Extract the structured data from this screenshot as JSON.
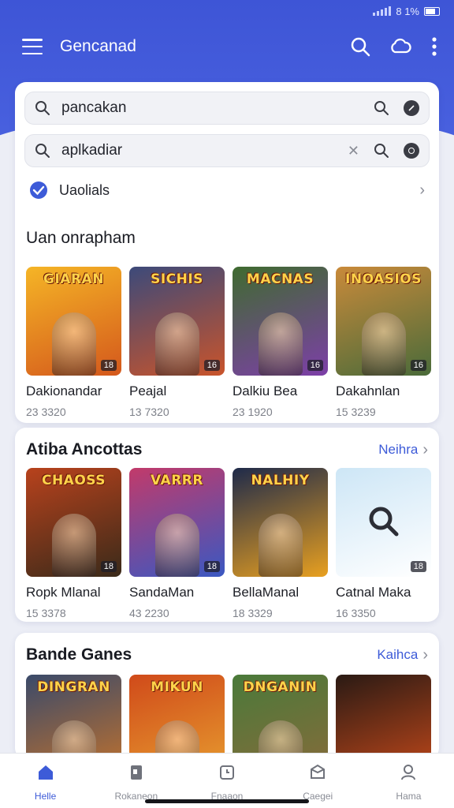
{
  "status": {
    "time": "8 1%",
    "signal": "signal-icon"
  },
  "app_bar": {
    "title": "Gencanad"
  },
  "search": {
    "field1_value": "pancakan",
    "field2_value": "aplkadiar"
  },
  "check_row": {
    "label": "Uaolials"
  },
  "section1": {
    "title": "Uan onrapham",
    "items": [
      {
        "art": "GIARAN",
        "name": "Dakionandar",
        "meta": "23 3320",
        "badge": "18",
        "colors": [
          "#f5b526",
          "#d4581c"
        ]
      },
      {
        "art": "SICHIS",
        "name": "Peajal",
        "meta": "13 7320",
        "badge": "16",
        "colors": [
          "#3c4a7a",
          "#c9542b"
        ]
      },
      {
        "art": "MACNAS",
        "name": "Dalkiu Bea",
        "meta": "23 1920",
        "badge": "16",
        "colors": [
          "#3f6b2f",
          "#7d3fa8"
        ]
      },
      {
        "art": "INOASIOS",
        "name": "Dakahnlan",
        "meta": "15 3239",
        "badge": "16",
        "colors": [
          "#c98a3a",
          "#4a6b3a"
        ]
      }
    ]
  },
  "section2": {
    "title": "Atiba Ancottas",
    "see_more": "Neihra",
    "items": [
      {
        "art": "CHAOSS",
        "name": "Ropk Mlanal",
        "meta": "15 3378",
        "badge": "18",
        "colors": [
          "#b8421c",
          "#3a2a1a"
        ]
      },
      {
        "art": "VARRR",
        "name": "SandaMan",
        "meta": "43 2230",
        "badge": "18",
        "colors": [
          "#c23a6a",
          "#3a58c2"
        ]
      },
      {
        "art": "NALHIY",
        "name": "BellaManal",
        "meta": "18 3329",
        "badge": "",
        "colors": [
          "#1e2a4a",
          "#e8a020"
        ]
      },
      {
        "art": "",
        "name": "Catnal Maka",
        "meta": "16 3350",
        "badge": "18",
        "colors": [
          "#cde6f6",
          "#ffffff"
        ]
      }
    ]
  },
  "section3": {
    "title": "Bande Ganes",
    "see_more": "Kaihca",
    "items": [
      {
        "art": "DINGRAN",
        "colors": [
          "#3a4a6a",
          "#c8742a"
        ]
      },
      {
        "art": "MIKUN",
        "colors": [
          "#d04a1a",
          "#e8a030"
        ]
      },
      {
        "art": "DNGANIN",
        "colors": [
          "#4a7a3a",
          "#8a6a3a"
        ]
      },
      {
        "art": "",
        "colors": [
          "#2a1a14",
          "#c84a1a"
        ]
      }
    ]
  },
  "bottom_nav": [
    {
      "label": "Helle",
      "icon": "home-icon"
    },
    {
      "label": "Rokaneon",
      "icon": "bookmark-icon"
    },
    {
      "label": "Fnaaon",
      "icon": "clock-icon"
    },
    {
      "label": "Caegei",
      "icon": "box-icon"
    },
    {
      "label": "Hama",
      "icon": "person-icon"
    }
  ],
  "colors": {
    "primary": "#3e55d6",
    "accent": "#3d5bd8"
  }
}
